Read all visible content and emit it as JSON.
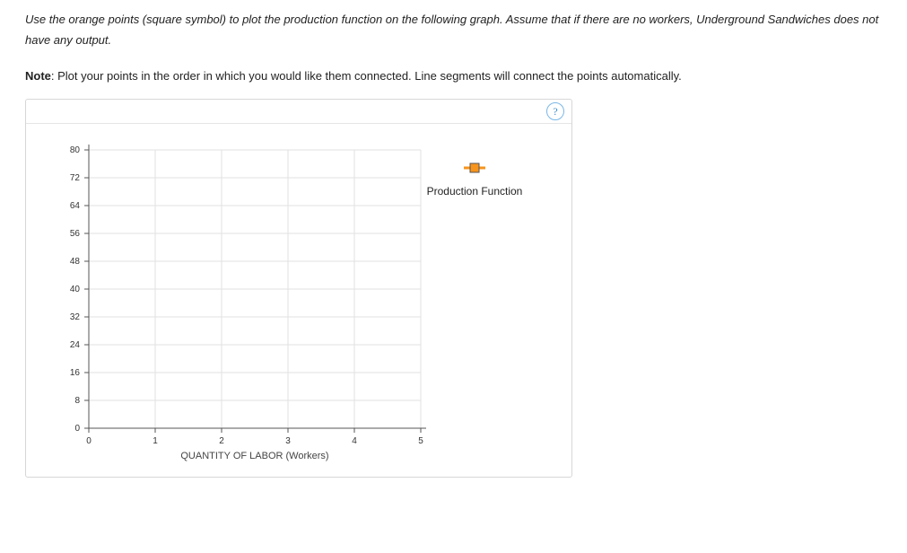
{
  "instructions": {
    "line1": "Use the orange points (square symbol) to plot the production function on the following graph. Assume that if there are no workers, Underground Sandwiches does not have any output.",
    "note_prefix": "Note",
    "note_body": ": Plot your points in the order in which you would like them connected. Line segments will connect the points automatically."
  },
  "help_label": "?",
  "legend": {
    "label": "Production Function"
  },
  "chart_data": {
    "type": "scatter",
    "title": "",
    "xlabel": "QUANTITY OF LABOR (Workers)",
    "ylabel": "",
    "xlim": [
      0,
      5
    ],
    "ylim": [
      0,
      80
    ],
    "xticks": [
      0,
      1,
      2,
      3,
      4,
      5
    ],
    "yticks": [
      0,
      8,
      16,
      24,
      32,
      40,
      48,
      56,
      64,
      72,
      80
    ],
    "series": [
      {
        "name": "Production Function",
        "symbol": "square",
        "color": "#f7941d",
        "values": []
      }
    ]
  }
}
